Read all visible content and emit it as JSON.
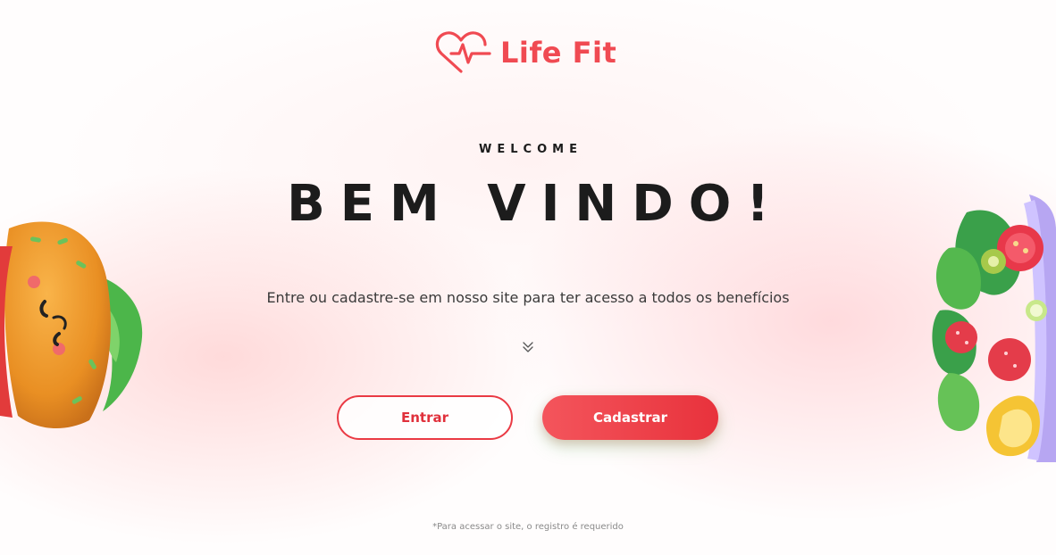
{
  "brand": {
    "name": "Life Fit",
    "logo_icon": "heart-pulse-icon",
    "accent_color": "#f04a52"
  },
  "hero": {
    "eyebrow": "WELCOME",
    "title": "BEM VINDO!",
    "subtitle": "Entre ou cadastre-se em nosso site para ter acesso a todos os benefícios",
    "scroll_icon": "double-chevron-down-icon"
  },
  "actions": {
    "login_label": "Entrar",
    "signup_label": "Cadastrar"
  },
  "footer": {
    "note": "*Para acessar o site, o registro é requerido"
  },
  "decorations": {
    "left": "burger-illustration",
    "right": "salad-bowl-illustration"
  }
}
